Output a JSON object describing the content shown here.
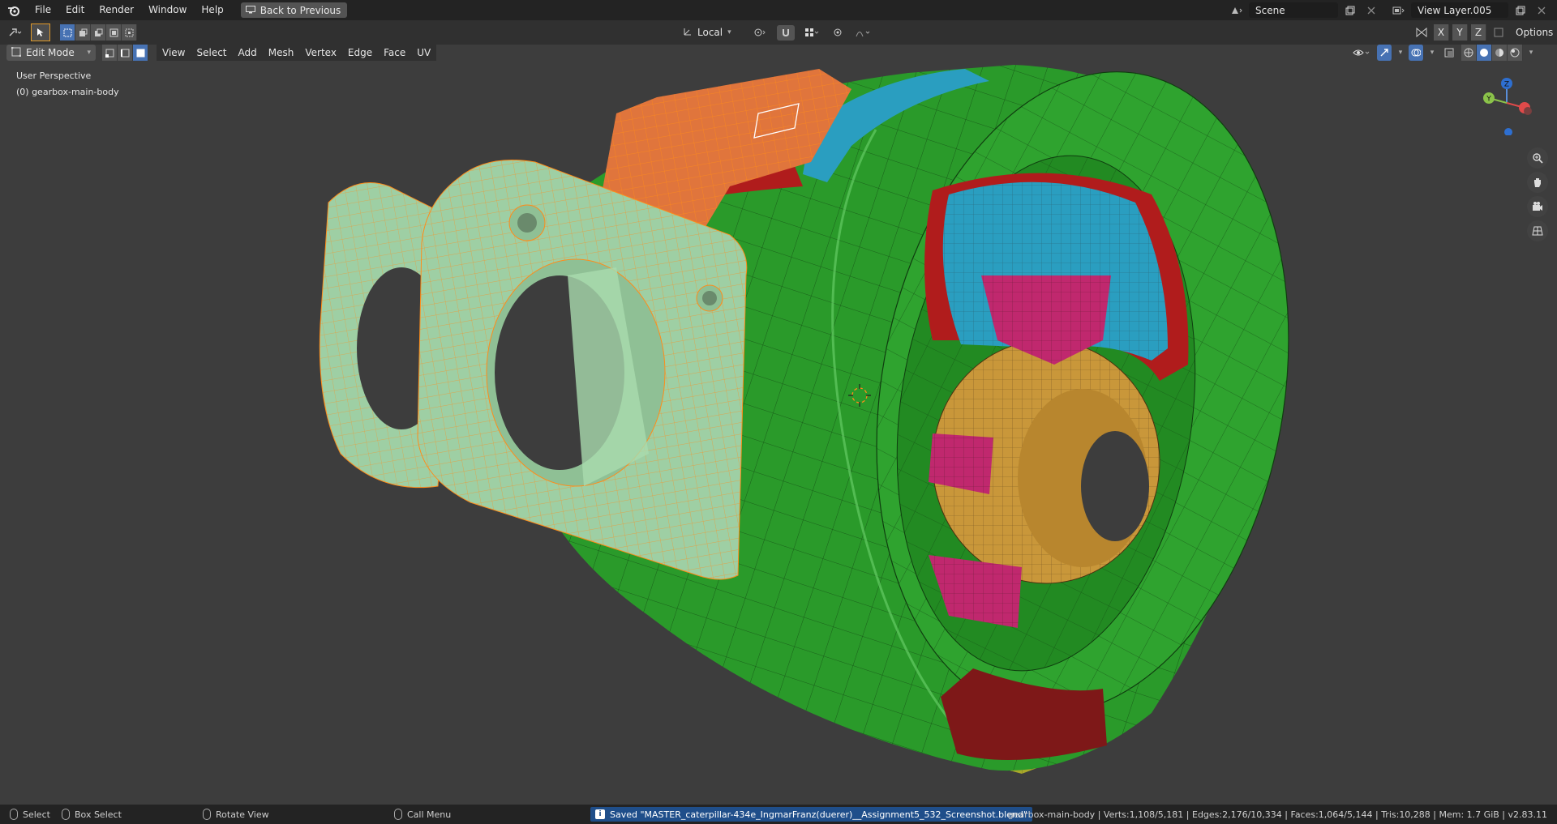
{
  "menu": {
    "items": [
      "File",
      "Edit",
      "Render",
      "Window",
      "Help"
    ],
    "back_label": "Back to Previous"
  },
  "scene": {
    "name": "Scene",
    "view_layer": "View Layer.005"
  },
  "header": {
    "orientation": "Local",
    "mode": "Edit Mode",
    "menus": [
      "View",
      "Select",
      "Add",
      "Mesh",
      "Vertex",
      "Edge",
      "Face",
      "UV"
    ],
    "axes": [
      "X",
      "Y",
      "Z"
    ],
    "options_label": "Options"
  },
  "viewport": {
    "perspective": "User Perspective",
    "object_label": "(0) gearbox-main-body",
    "gizmo_axes": [
      "Z",
      "Y"
    ]
  },
  "status": {
    "select": "Select",
    "box_select": "Box Select",
    "rotate_view": "Rotate View",
    "call_menu": "Call Menu",
    "saved_message": "Saved \"MASTER_caterpillar-434e_IngmarFranz(duerer)__Assignment5_532_Screenshot.blend\"",
    "stats": "gearbox-main-body | Verts:1,108/5,181 | Edges:2,176/10,334 | Faces:1,064/5,144 | Tris:10,288 | Mem: 1.7 GiB | v2.83.11"
  },
  "colors": {
    "green": "#2a9a2a",
    "dark_green": "#1f7a1f",
    "red": "#b01c1c",
    "dark_red": "#7e1818",
    "blue": "#2a9ec0",
    "magenta": "#c0286e",
    "gold": "#c9973a",
    "yellow": "#a8a82a",
    "selected_orange": "#e0753c",
    "selected_mint": "#9ecfa4",
    "wire_selected": "#ff8c1a"
  }
}
